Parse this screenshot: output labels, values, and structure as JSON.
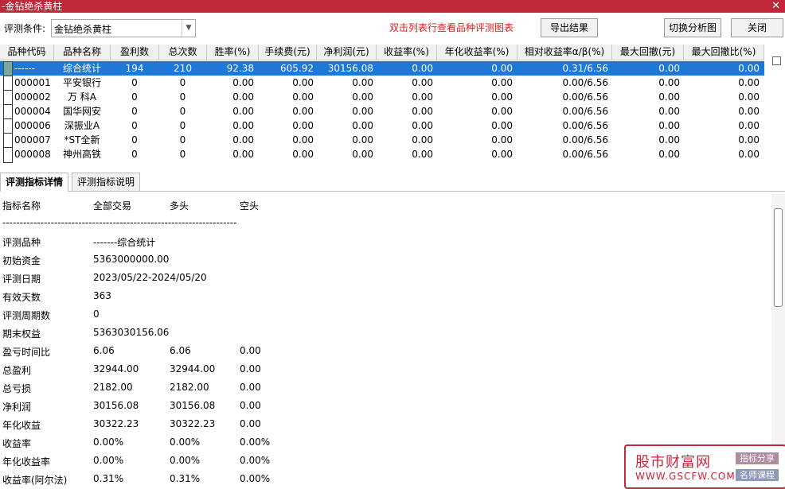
{
  "window": {
    "title": "-金钻绝杀黄柱",
    "close": "✕"
  },
  "toolbar": {
    "condition_label": "评测条件:",
    "condition_value": "金钻绝杀黄柱",
    "hint": "双击列表行查看品种评测图表",
    "export_label": "导出结果",
    "switch_label": "切换分析图",
    "close_label": "关闭"
  },
  "table": {
    "columns": [
      "品种代码",
      "品种名称",
      "盈利数",
      "总次数",
      "胜率(%)",
      "手续费(元)",
      "净利润(元)",
      "收益率(%)",
      "年化收益率(%)",
      "相对收益率α/β(%)",
      "最大回撤(元)",
      "最大回撤比(%)"
    ],
    "rows": [
      {
        "code": "------",
        "name": "综合统计",
        "profit": "194",
        "total": "210",
        "win": "92.38",
        "fee": "605.92",
        "net": "30156.08",
        "yield": "0.00",
        "annual": "0.00",
        "rel": "0.31/6.56",
        "dd": "0.00",
        "ddr": "0.00"
      },
      {
        "code": "000001",
        "name": "平安银行",
        "profit": "0",
        "total": "0",
        "win": "0.00",
        "fee": "0.00",
        "net": "0.00",
        "yield": "0.00",
        "annual": "0.00",
        "rel": "0.00/6.56",
        "dd": "0.00",
        "ddr": "0.00"
      },
      {
        "code": "000002",
        "name": "万 科A",
        "profit": "0",
        "total": "0",
        "win": "0.00",
        "fee": "0.00",
        "net": "0.00",
        "yield": "0.00",
        "annual": "0.00",
        "rel": "0.00/6.56",
        "dd": "0.00",
        "ddr": "0.00"
      },
      {
        "code": "000004",
        "name": "国华网安",
        "profit": "0",
        "total": "0",
        "win": "0.00",
        "fee": "0.00",
        "net": "0.00",
        "yield": "0.00",
        "annual": "0.00",
        "rel": "0.00/6.56",
        "dd": "0.00",
        "ddr": "0.00"
      },
      {
        "code": "000006",
        "name": "深振业A",
        "profit": "0",
        "total": "0",
        "win": "0.00",
        "fee": "0.00",
        "net": "0.00",
        "yield": "0.00",
        "annual": "0.00",
        "rel": "0.00/6.56",
        "dd": "0.00",
        "ddr": "0.00"
      },
      {
        "code": "000007",
        "name": "*ST全新",
        "profit": "0",
        "total": "0",
        "win": "0.00",
        "fee": "0.00",
        "net": "0.00",
        "yield": "0.00",
        "annual": "0.00",
        "rel": "0.00/6.56",
        "dd": "0.00",
        "ddr": "0.00"
      },
      {
        "code": "000008",
        "name": "神州高铁",
        "profit": "0",
        "total": "0",
        "win": "0.00",
        "fee": "0.00",
        "net": "0.00",
        "yield": "0.00",
        "annual": "0.00",
        "rel": "0.00/6.56",
        "dd": "0.00",
        "ddr": "0.00"
      }
    ]
  },
  "tabs": [
    "评测指标详情",
    "评测指标说明"
  ],
  "detail": {
    "header": [
      "指标名称",
      "全部交易",
      "多头",
      "空头"
    ],
    "separator": "--------------------------------------------------------------------",
    "items": [
      {
        "label": "评测品种",
        "v1": "-------综合统计",
        "v2": "",
        "v3": ""
      },
      {
        "label": "初始资金",
        "v1": "5363000000.00",
        "v2": "",
        "v3": ""
      },
      {
        "label": "评测日期",
        "v1": "2023/05/22-2024/05/20",
        "v2": "",
        "v3": ""
      },
      {
        "label": "有效天数",
        "v1": "363",
        "v2": "",
        "v3": ""
      },
      {
        "label": "评测周期数",
        "v1": "0",
        "v2": "",
        "v3": ""
      },
      {
        "label": "期末权益",
        "v1": "5363030156.06",
        "v2": "",
        "v3": ""
      },
      {
        "label": "盈亏时间比",
        "v1": "6.06",
        "v2": "6.06",
        "v3": "0.00"
      },
      {
        "label": "总盈利",
        "v1": "32944.00",
        "v2": "32944.00",
        "v3": "0.00"
      },
      {
        "label": "总亏损",
        "v1": "2182.00",
        "v2": "2182.00",
        "v3": "0.00"
      },
      {
        "label": "净利润",
        "v1": "30156.08",
        "v2": "30156.08",
        "v3": "0.00"
      },
      {
        "label": "年化收益",
        "v1": "30322.23",
        "v2": "30322.23",
        "v3": "0.00"
      },
      {
        "label": "收益率",
        "v1": "0.00%",
        "v2": "0.00%",
        "v3": "0.00%"
      },
      {
        "label": "年化收益率",
        "v1": "0.00%",
        "v2": "0.00%",
        "v3": "0.00%"
      },
      {
        "label": "收益率(阿尔法)",
        "v1": "0.31%",
        "v2": "0.31%",
        "v3": "0.00%"
      }
    ]
  },
  "watermark": {
    "brand": "股市财富网",
    "url": "WWW.GSCFW.COM",
    "badge1": "指标分享",
    "badge2": "名师课程"
  },
  "colors": {
    "titlebar": "#c0283a",
    "selection": "#1e78d8",
    "hint": "#e01b1b"
  }
}
